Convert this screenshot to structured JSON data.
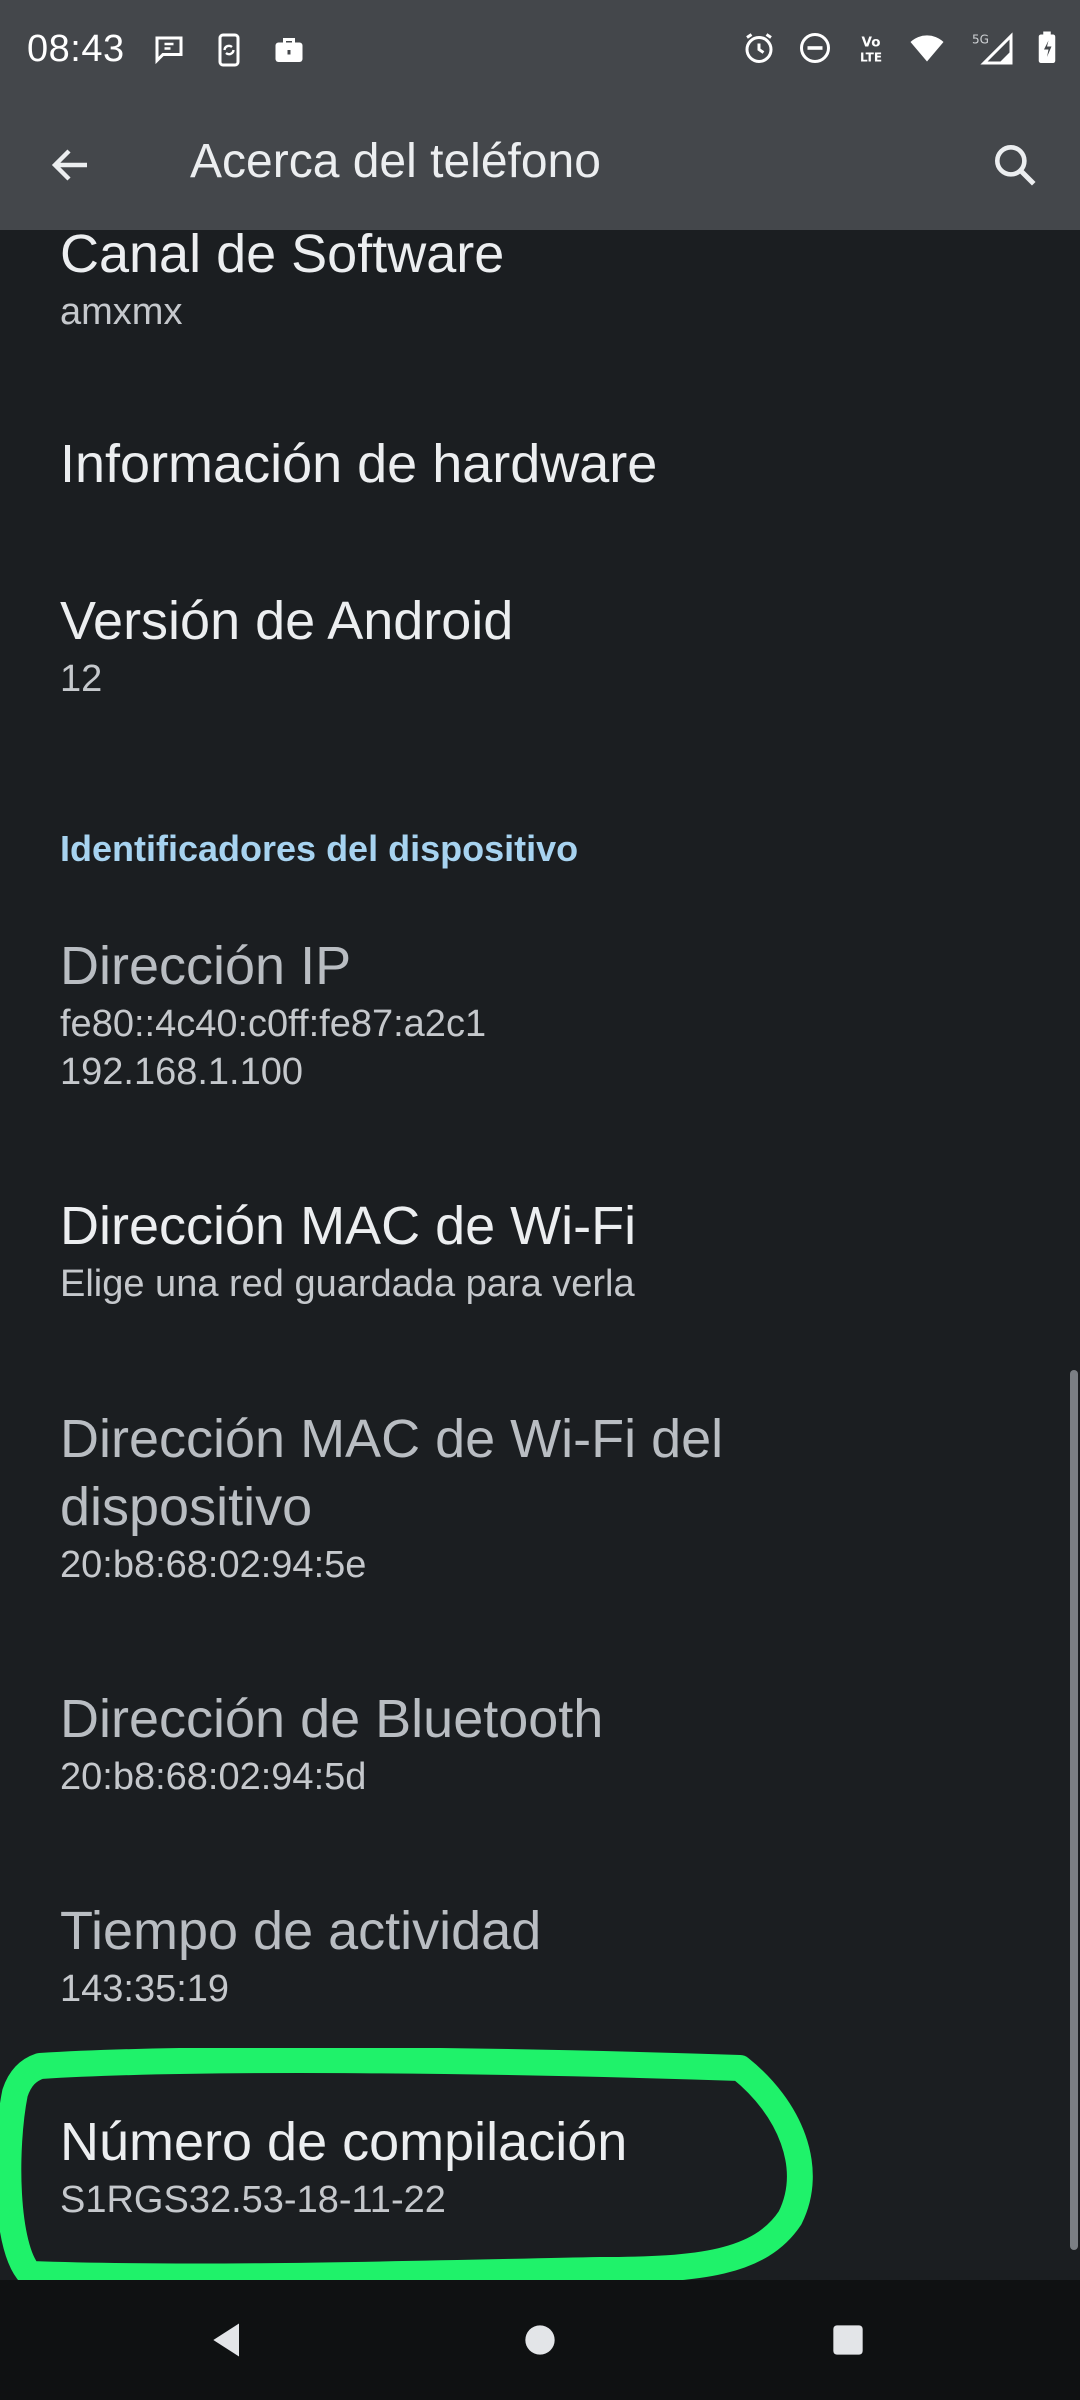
{
  "status_bar": {
    "time": "08:43",
    "left_icons": [
      "chat-bubble-icon",
      "phone-sync-icon",
      "briefcase-icon"
    ],
    "right_icons": [
      "alarm-icon",
      "do-not-disturb-icon",
      "volte-icon",
      "wifi-icon",
      "signal-5g-icon",
      "battery-icon"
    ],
    "volte_text": "Vo LTE",
    "network_text": "5G"
  },
  "app_bar": {
    "title": "Acerca del teléfono",
    "back_icon": "arrow-back-icon",
    "search_icon": "search-icon"
  },
  "items": {
    "software_channel": {
      "title": "Canal de Software",
      "summary": "amxmx"
    },
    "hardware_info": {
      "title": "Información de hardware"
    },
    "android_version": {
      "title": "Versión de Android",
      "summary": "12"
    },
    "section_header": "Identificadores del dispositivo",
    "ip_address": {
      "title": "Dirección IP",
      "summary": "fe80::4c40:c0ff:fe87:a2c1\n192.168.1.100"
    },
    "wifi_mac": {
      "title": "Dirección MAC de Wi-Fi",
      "summary": "Elige una red guardada para verla"
    },
    "device_wifi_mac": {
      "title": "Dirección MAC de Wi-Fi del dispositivo",
      "summary": "20:b8:68:02:94:5e"
    },
    "bluetooth_address": {
      "title": "Dirección de Bluetooth",
      "summary": "20:b8:68:02:94:5d"
    },
    "uptime": {
      "title": "Tiempo de actividad",
      "summary": "143:35:19"
    },
    "build_number": {
      "title": "Número de compilación",
      "summary": "S1RGS32.53-18-11-22"
    }
  },
  "nav_bar": {
    "icons": [
      "nav-back-icon",
      "nav-home-icon",
      "nav-recents-icon"
    ]
  },
  "colors": {
    "background": "#1b1e21",
    "app_bar": "#44474b",
    "section_header": "#a7d3f0",
    "highlight": "#1ff26a"
  }
}
